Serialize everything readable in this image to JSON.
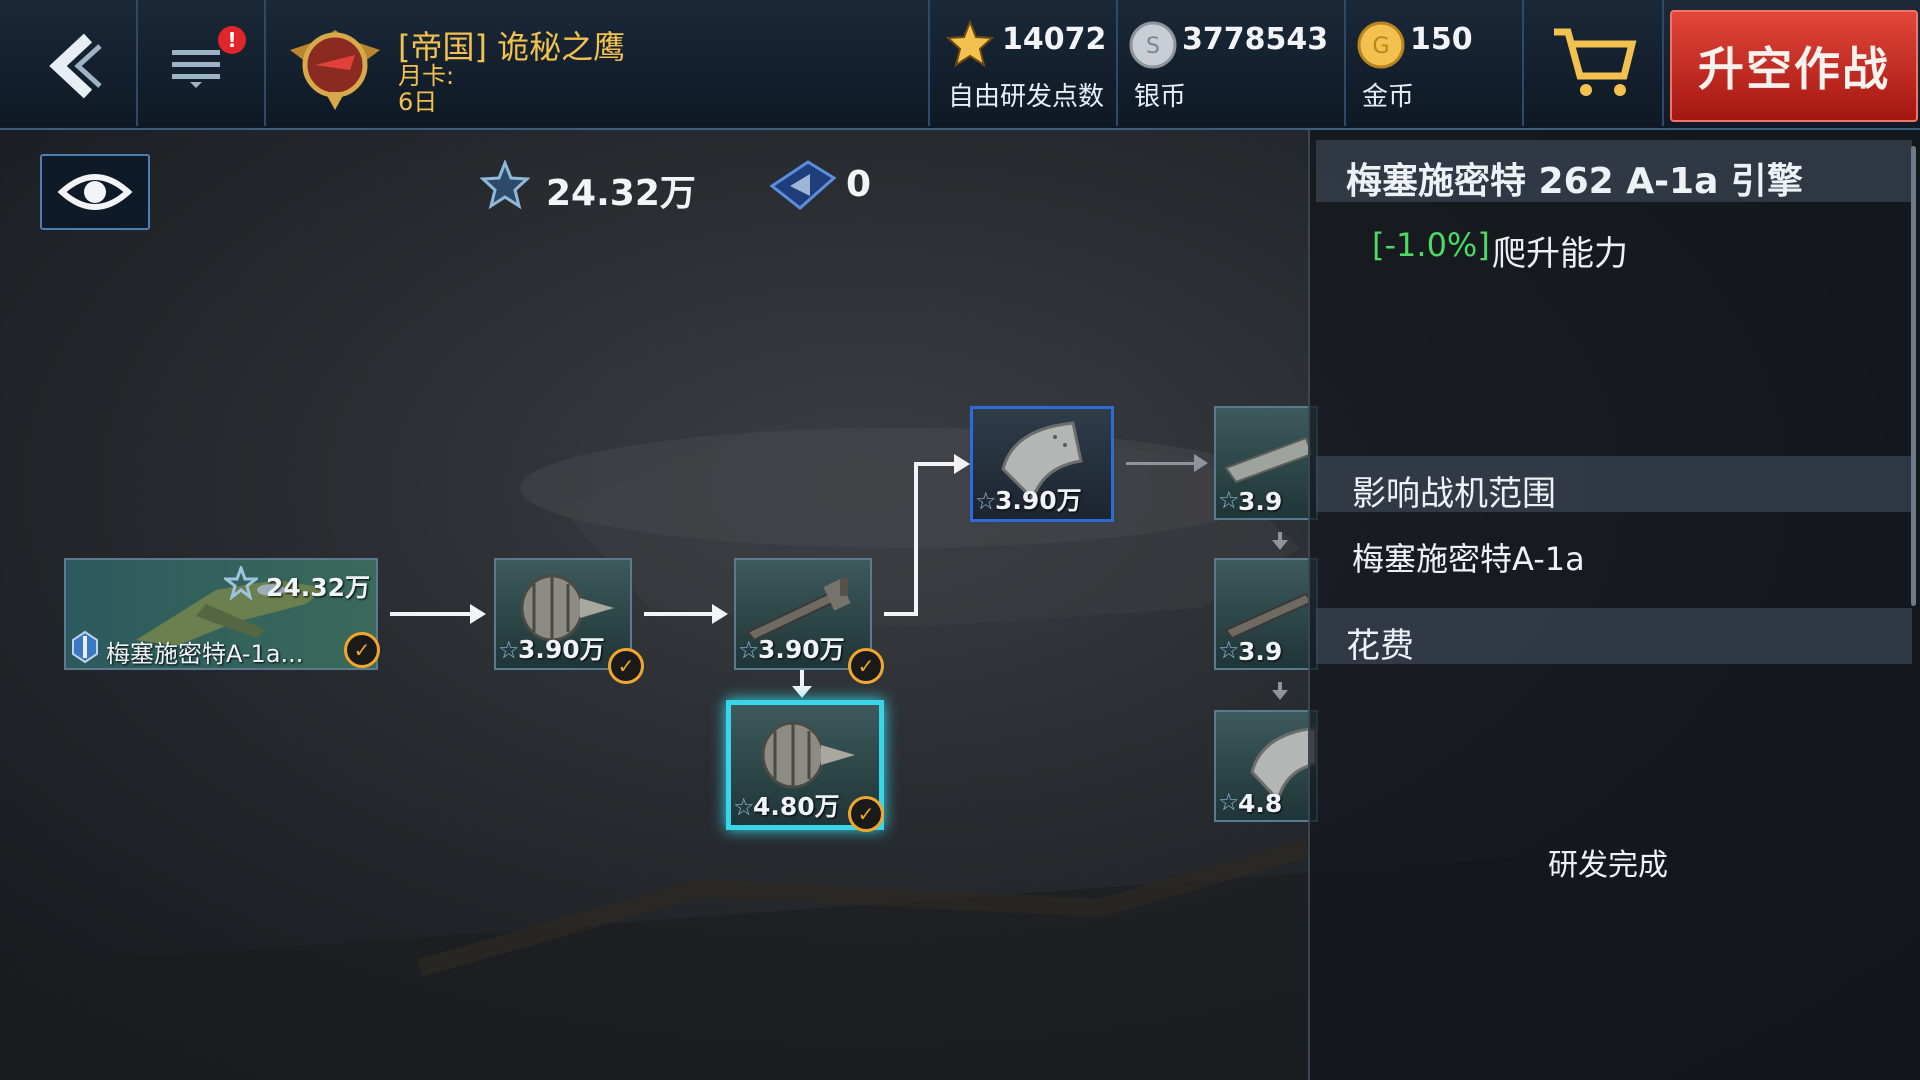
{
  "header": {
    "player_name": "[帝国] 诡秘之鹰",
    "month_card_label": "月卡:",
    "month_card_days": "6日",
    "notification_badge": "!",
    "resources": [
      {
        "icon": "star-icon",
        "value": "14072",
        "label": "自由研发点数"
      },
      {
        "icon": "silver-coin-icon",
        "value": "3778543",
        "label": "银币"
      },
      {
        "icon": "gold-coin-icon",
        "value": "150",
        "label": "金币"
      }
    ],
    "fly_button_label": "升空作战"
  },
  "stats": {
    "research_points": "24.32万",
    "tickets": "0"
  },
  "tree": {
    "root": {
      "name": "梅塞施密特A-1a...",
      "cost": "24.32万"
    },
    "nodes": [
      {
        "id": "engine-1",
        "cost": "3.90万",
        "completed": true
      },
      {
        "id": "gun-1",
        "cost": "3.90万",
        "completed": true
      },
      {
        "id": "engine-2",
        "cost": "4.80万",
        "completed": true,
        "selected": true
      },
      {
        "id": "armor-1",
        "cost": "3.90万",
        "completed": false,
        "highlighted": true
      },
      {
        "id": "fuselage-1",
        "cost": "3.9",
        "completed": false
      },
      {
        "id": "gun-2",
        "cost": "3.9",
        "completed": false
      },
      {
        "id": "armor-2",
        "cost": "4.8",
        "completed": false
      }
    ]
  },
  "panel": {
    "title": "梅塞施密特 262 A-1a 引擎",
    "stat_delta": "[-1.0%]",
    "stat_name": "爬升能力",
    "affects_heading": "影响战机范围",
    "affects_value": "梅塞施密特A-1a",
    "cost_heading": "花费",
    "status": "研发完成"
  },
  "colors": {
    "accent_gold": "#f2c14e",
    "fly_button": "#c42a20",
    "selected_cyan": "#38d6e8",
    "positive_green": "#4cd964"
  }
}
